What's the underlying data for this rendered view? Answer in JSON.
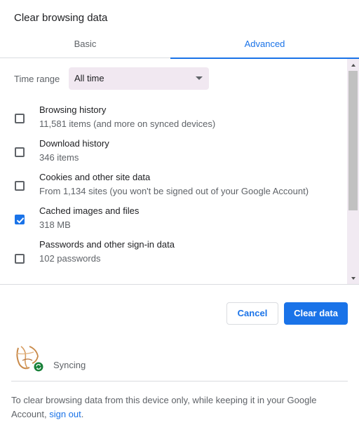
{
  "dialog": {
    "title": "Clear browsing data"
  },
  "tabs": [
    {
      "label": "Basic",
      "selected": false
    },
    {
      "label": "Advanced",
      "selected": true
    }
  ],
  "time_range": {
    "label": "Time range",
    "value": "All time"
  },
  "options": [
    {
      "title": "Browsing history",
      "subtitle": "11,581 items (and more on synced devices)",
      "checked": false
    },
    {
      "title": "Download history",
      "subtitle": "346 items",
      "checked": false
    },
    {
      "title": "Cookies and other site data",
      "subtitle": "From 1,134 sites (you won't be signed out of your Google Account)",
      "checked": false
    },
    {
      "title": "Cached images and files",
      "subtitle": "318 MB",
      "checked": true
    },
    {
      "title": "Passwords and other sign-in data",
      "subtitle": "102 passwords",
      "checked": false
    }
  ],
  "buttons": {
    "cancel": "Cancel",
    "clear": "Clear data"
  },
  "sync": {
    "status": "Syncing"
  },
  "footer": {
    "text": "To clear browsing data from this device only, while keeping it in your Google Account, ",
    "link": "sign out",
    "end": "."
  },
  "colors": {
    "accent": "#1a73e8",
    "sync_badge": "#188038"
  }
}
